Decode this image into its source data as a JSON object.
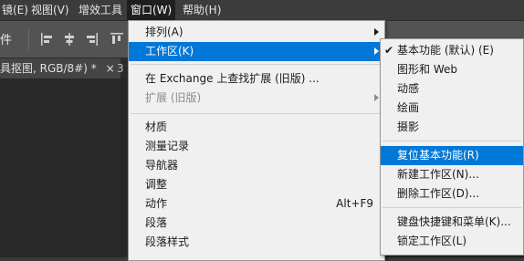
{
  "menubar": {
    "items": [
      "镜(E)",
      "视图(V)",
      "增效工具",
      "窗口(W)",
      "帮助(H)"
    ]
  },
  "options_bar": {
    "label": "件"
  },
  "document_tabs": {
    "current": "具抠图, RGB/8#) *",
    "close_glyph": "×",
    "next": "3"
  },
  "window_menu": {
    "items": [
      {
        "label": "排列(A)",
        "submenu": true
      },
      {
        "label": "工作区(K)",
        "submenu": true,
        "selected": true
      },
      {
        "label": "在 Exchange 上查找扩展 (旧版) ..."
      },
      {
        "label": "扩展 (旧版)",
        "submenu": true,
        "disabled": true
      },
      {
        "label": "材质"
      },
      {
        "label": "测量记录"
      },
      {
        "label": "导航器"
      },
      {
        "label": "调整"
      },
      {
        "label": "动作",
        "shortcut": "Alt+F9"
      },
      {
        "label": "段落"
      },
      {
        "label": "段落样式"
      }
    ]
  },
  "workspace_submenu": {
    "check_glyph": "✔",
    "items": [
      {
        "label": "基本功能 (默认) (E)",
        "checked": true
      },
      {
        "label": "图形和 Web"
      },
      {
        "label": "动感"
      },
      {
        "label": "绘画"
      },
      {
        "label": "摄影"
      },
      {
        "label": "复位基本功能(R)",
        "selected": true
      },
      {
        "label": "新建工作区(N)..."
      },
      {
        "label": "删除工作区(D)..."
      },
      {
        "label": "键盘快捷键和菜单(K)..."
      },
      {
        "label": "锁定工作区(L)"
      }
    ]
  },
  "colors": {
    "highlight": "#0078d7",
    "menu_bg": "#f0f0f0",
    "app_bg": "#535353"
  }
}
